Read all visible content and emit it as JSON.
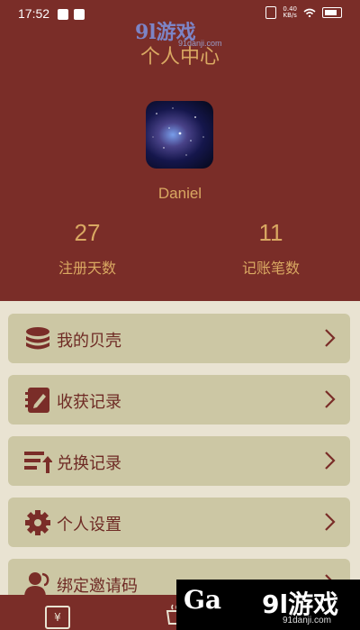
{
  "status_bar": {
    "time": "17:52",
    "net_speed": "0.40\nKB/s"
  },
  "watermark": {
    "top_logo": "9l游戏",
    "top_url": "91danji.com",
    "bottom_logo": "9l游戏",
    "bottom_url": "91danji.com",
    "bottom_ga": "Ga"
  },
  "header": {
    "title": "个人中心",
    "username": "Daniel",
    "stats": [
      {
        "value": "27",
        "label": "注册天数"
      },
      {
        "value": "11",
        "label": "记账笔数"
      }
    ]
  },
  "menu": [
    {
      "label": "我的贝壳",
      "icon": "coins-icon"
    },
    {
      "label": "收获记录",
      "icon": "notebook-pencil-icon"
    },
    {
      "label": "兑换记录",
      "icon": "list-upload-icon"
    },
    {
      "label": "个人设置",
      "icon": "gear-icon"
    },
    {
      "label": "绑定邀请码",
      "icon": "users-icon"
    }
  ],
  "tabbar": {
    "yen_tab": "¥"
  },
  "colors": {
    "header_bg": "#7a2d28",
    "accent_gold": "#d9a862",
    "card_bg": "#ccc7a4",
    "card_text": "#6e2a24",
    "page_bg": "#e9e3d2"
  }
}
